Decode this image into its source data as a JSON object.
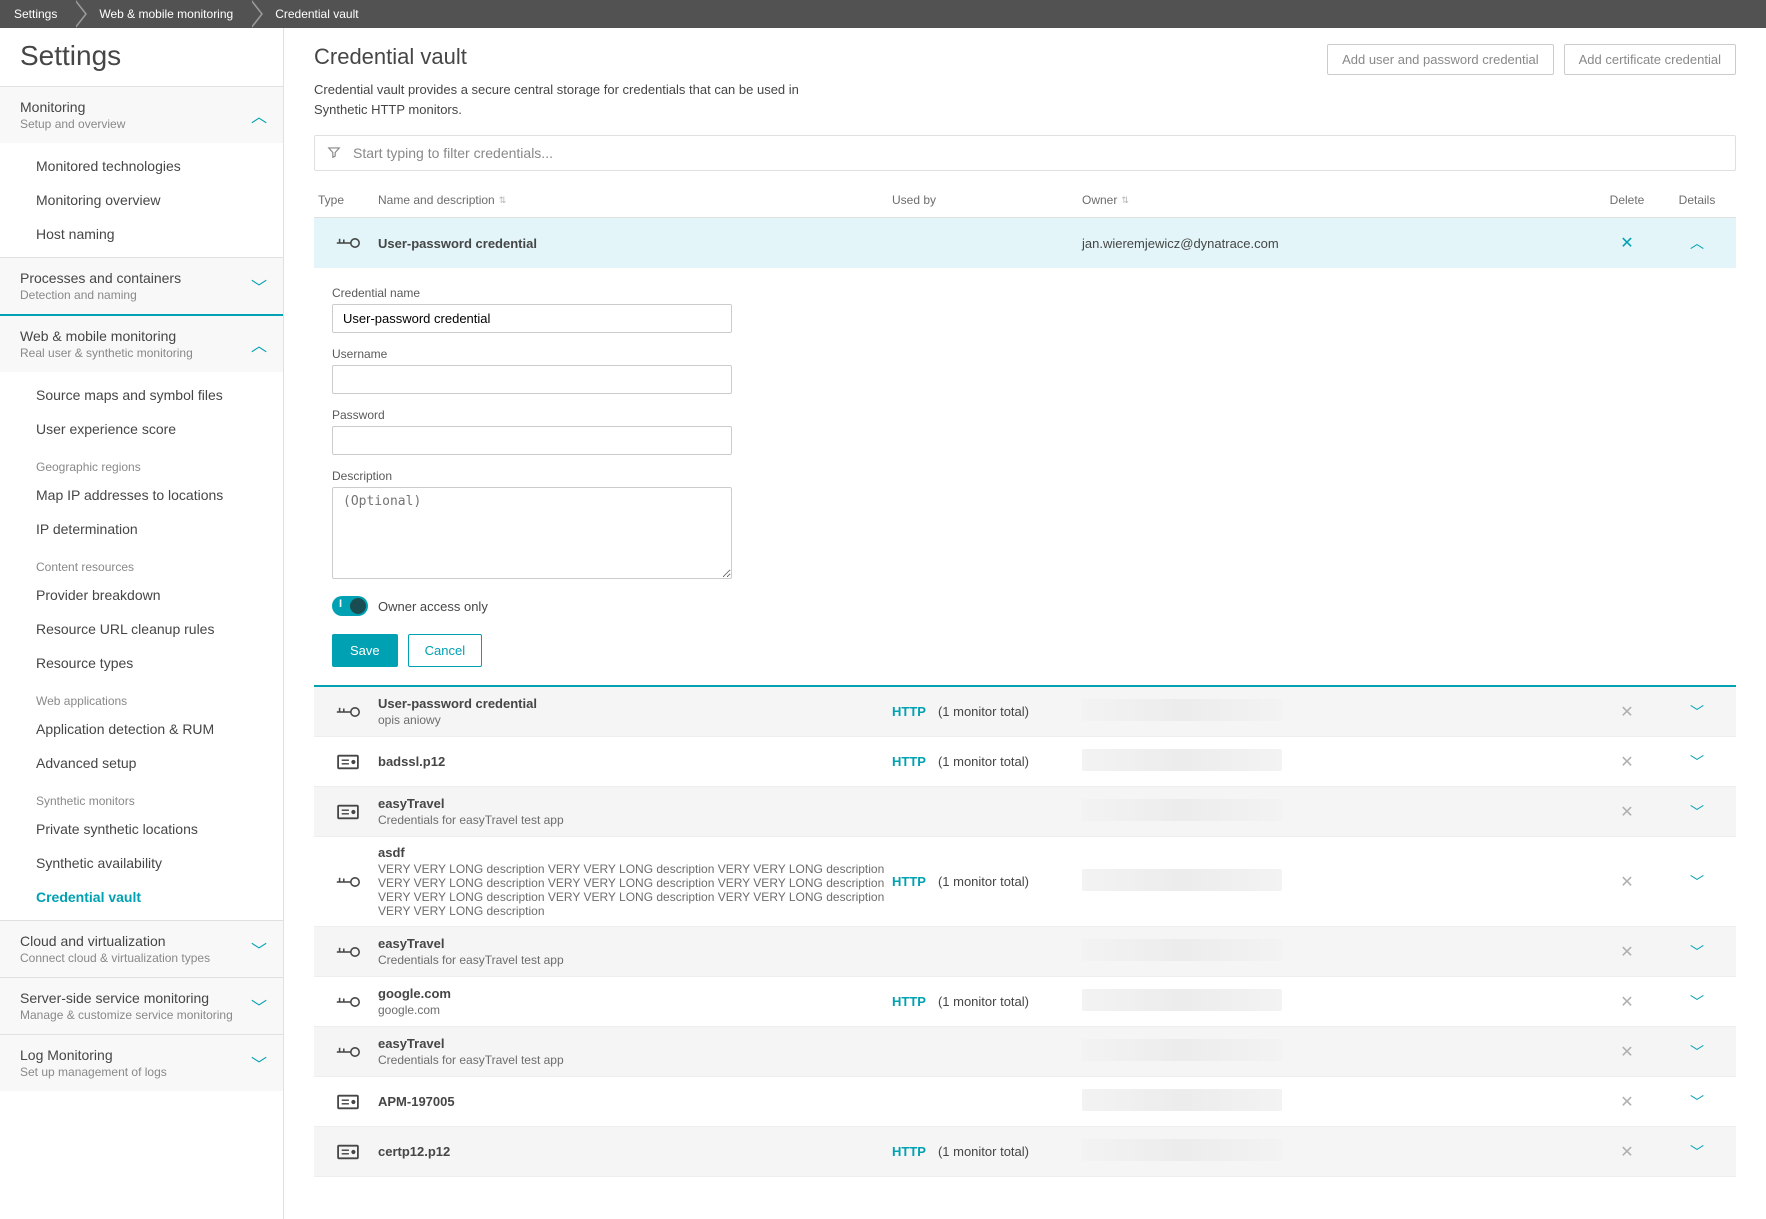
{
  "breadcrumb": [
    "Settings",
    "Web & mobile monitoring",
    "Credential vault"
  ],
  "sidebar": {
    "title": "Settings",
    "sections": [
      {
        "title": "Monitoring",
        "sub": "Setup and overview",
        "expanded": true,
        "items": [
          {
            "label": "Monitored technologies"
          },
          {
            "label": "Monitoring overview"
          },
          {
            "label": "Host naming"
          }
        ]
      },
      {
        "title": "Processes and containers",
        "sub": "Detection and naming",
        "expanded": false,
        "items": []
      },
      {
        "title": "Web & mobile monitoring",
        "sub": "Real user & synthetic monitoring",
        "expanded": true,
        "activeBorder": true,
        "items": [
          {
            "label": "Source maps and symbol files"
          },
          {
            "label": "User experience score"
          }
        ],
        "groups": [
          {
            "header": "Geographic regions",
            "items": [
              {
                "label": "Map IP addresses to locations"
              },
              {
                "label": "IP determination"
              }
            ]
          },
          {
            "header": "Content resources",
            "items": [
              {
                "label": "Provider breakdown"
              },
              {
                "label": "Resource URL cleanup rules"
              },
              {
                "label": "Resource types"
              }
            ]
          },
          {
            "header": "Web applications",
            "items": [
              {
                "label": "Application detection & RUM"
              },
              {
                "label": "Advanced setup"
              }
            ]
          },
          {
            "header": "Synthetic monitors",
            "items": [
              {
                "label": "Private synthetic locations"
              },
              {
                "label": "Synthetic availability"
              },
              {
                "label": "Credential vault",
                "active": true
              }
            ]
          }
        ]
      },
      {
        "title": "Cloud and virtualization",
        "sub": "Connect cloud & virtualization types",
        "expanded": false,
        "items": []
      },
      {
        "title": "Server-side service monitoring",
        "sub": "Manage & customize service monitoring",
        "expanded": false,
        "items": []
      },
      {
        "title": "Log Monitoring",
        "sub": "Set up management of logs",
        "expanded": false,
        "items": []
      }
    ]
  },
  "page": {
    "title": "Credential vault",
    "desc": "Credential vault provides a secure central storage for credentials that can be used in Synthetic HTTP monitors.",
    "add_userpass": "Add user and password credential",
    "add_cert": "Add certificate credential",
    "filter_placeholder": "Start typing to filter credentials..."
  },
  "table": {
    "cols": {
      "type": "Type",
      "name": "Name and description",
      "usedby": "Used by",
      "owner": "Owner",
      "delete": "Delete",
      "details": "Details"
    }
  },
  "expanded": {
    "name": "User-password credential",
    "owner": "jan.wieremjewicz@dynatrace.com",
    "form": {
      "credname_label": "Credential name",
      "credname_value": "User-password credential",
      "username_label": "Username",
      "username_value": "",
      "password_label": "Password",
      "password_value": "",
      "desc_label": "Description",
      "desc_placeholder": "(Optional)",
      "owner_only": "Owner access only",
      "save": "Save",
      "cancel": "Cancel"
    }
  },
  "rows": [
    {
      "type": "key",
      "name": "User-password credential",
      "desc": "opis aniowy",
      "used_link": "HTTP",
      "used_text": "(1 monitor total)",
      "owner_hidden": true
    },
    {
      "type": "cert",
      "name": "badssl.p12",
      "desc": "",
      "used_link": "HTTP",
      "used_text": "(1 monitor total)",
      "owner_hidden": true
    },
    {
      "type": "cert",
      "name": "easyTravel",
      "desc": "Credentials for easyTravel test app",
      "used_link": "",
      "used_text": "",
      "owner_hidden": true
    },
    {
      "type": "key",
      "name": "asdf",
      "desc": "VERY VERY LONG description VERY VERY LONG description VERY VERY LONG description VERY VERY LONG description VERY VERY LONG description VERY VERY LONG description VERY VERY LONG description VERY VERY LONG description VERY VERY LONG description VERY VERY LONG description",
      "used_link": "HTTP",
      "used_text": "(1 monitor total)",
      "owner_hidden": true
    },
    {
      "type": "key",
      "name": "easyTravel",
      "desc": "Credentials for easyTravel test app",
      "used_link": "",
      "used_text": "",
      "owner_hidden": true
    },
    {
      "type": "key",
      "name": "google.com",
      "desc": "google.com",
      "used_link": "HTTP",
      "used_text": "(1 monitor total)",
      "owner_hidden": true
    },
    {
      "type": "key",
      "name": "easyTravel",
      "desc": "Credentials for easyTravel test app",
      "used_link": "",
      "used_text": "",
      "owner_hidden": true
    },
    {
      "type": "cert",
      "name": "APM-197005",
      "desc": "",
      "used_link": "",
      "used_text": "",
      "owner_hidden": true
    },
    {
      "type": "cert",
      "name": "certp12.p12",
      "desc": "",
      "used_link": "HTTP",
      "used_text": "(1 monitor total)",
      "owner_hidden": true
    }
  ]
}
